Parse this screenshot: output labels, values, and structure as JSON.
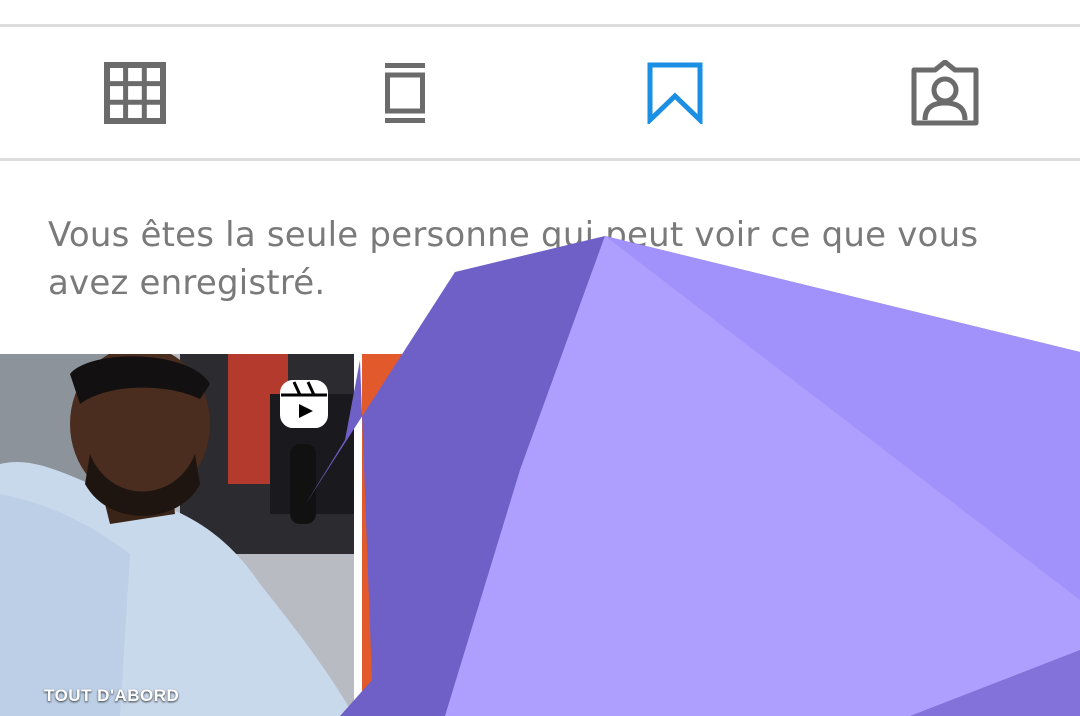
{
  "tabs": [
    {
      "name": "grid",
      "icon": "grid-icon",
      "active": false
    },
    {
      "name": "guides",
      "icon": "guide-icon",
      "active": false
    },
    {
      "name": "saved",
      "icon": "bookmark-icon",
      "active": true
    },
    {
      "name": "tagged",
      "icon": "tagged-person-icon",
      "active": false
    }
  ],
  "notice": {
    "text": "Vous êtes la seule personne qui peut voir ce que vous avez enregistré."
  },
  "saved_posts": [
    {
      "type": "reel",
      "caption": "TOUT D'ABORD",
      "icon": "reel-icon"
    },
    {
      "type": "post"
    }
  ],
  "colors": {
    "active_tab": "#1a8fe3",
    "inactive_tab": "#6b6b6b",
    "overlay_dark": "#6f60c8",
    "overlay_mid": "#a191fb",
    "overlay_light": "#ae9fff"
  }
}
